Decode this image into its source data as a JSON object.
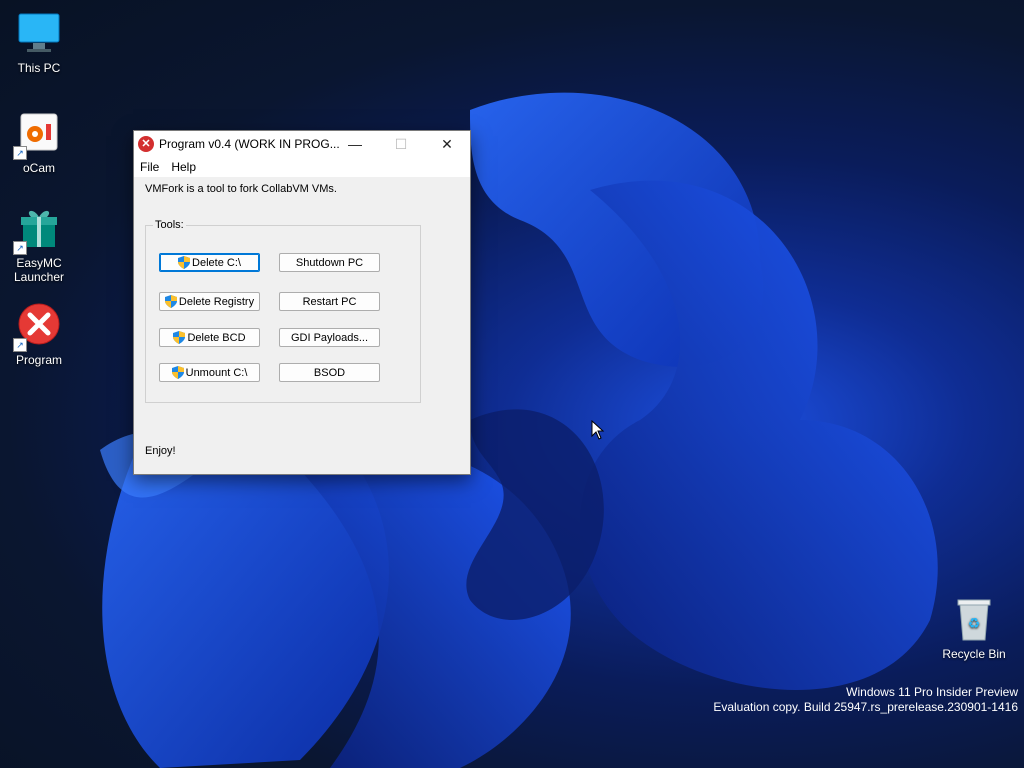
{
  "desktop": {
    "icons": [
      {
        "label": "This PC"
      },
      {
        "label": "oCam"
      },
      {
        "label": "EasyMC Launcher"
      },
      {
        "label": "Program"
      },
      {
        "label": "Recycle Bin"
      }
    ]
  },
  "window": {
    "title": "Program v0.4 (WORK IN PROG...",
    "controls": {
      "minimize": "—",
      "maximize": "☐",
      "close": "✕"
    },
    "menu": {
      "file": "File",
      "help": "Help"
    },
    "description": "VMFork is a tool to fork CollabVM VMs.",
    "tools_label": "Tools:",
    "buttons": {
      "delete_c": "Delete C:\\",
      "shutdown_pc": "Shutdown PC",
      "delete_registry": "Delete Registry",
      "restart_pc": "Restart PC",
      "delete_bcd": "Delete BCD",
      "gdi_payloads": "GDI Payloads...",
      "unmount_c": "Unmount C:\\",
      "bsod": "BSOD"
    },
    "footer": "Enjoy!"
  },
  "watermark": {
    "line1": "Windows 11 Pro Insider Preview",
    "line2": "Evaluation copy. Build 25947.rs_prerelease.230901-1416"
  },
  "colors": {
    "accent": "#0078d7",
    "error_red": "#d32f2f"
  }
}
